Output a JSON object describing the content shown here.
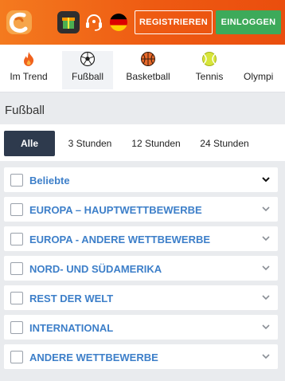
{
  "header": {
    "logo_icon": "bookmaker-logo-icon",
    "gift_icon": "gift-icon",
    "support_icon": "support-headset-icon",
    "flag_icon": "german-flag-icon",
    "register_label": "REGISTRIEREN",
    "login_label": "EINLOGGEN",
    "colors": {
      "bar": "#ee5a12",
      "login": "#3daa5a"
    }
  },
  "sport_tabs": [
    {
      "label": "Im Trend",
      "icon": "flame-icon",
      "active": false
    },
    {
      "label": "Fußball",
      "icon": "soccer-ball-icon",
      "active": true
    },
    {
      "label": "Basketball",
      "icon": "basketball-icon",
      "active": false
    },
    {
      "label": "Tennis",
      "icon": "tennis-ball-icon",
      "active": false
    },
    {
      "label": "Olympi",
      "icon": "",
      "active": false
    }
  ],
  "page_title": "Fußball",
  "time_filters": [
    {
      "label": "Alle",
      "active": true
    },
    {
      "label": "3 Stunden",
      "active": false
    },
    {
      "label": "12 Stunden",
      "active": false
    },
    {
      "label": "24 Stunden",
      "active": false
    }
  ],
  "leagues": [
    {
      "label": "Beliebte",
      "chevron": "chevron-down-icon-dark"
    },
    {
      "label": "EUROPA – HAUPTWETTBEWERBE",
      "chevron": "chevron-down-icon"
    },
    {
      "label": "EUROPA - ANDERE WETTBEWERBE",
      "chevron": "chevron-down-icon"
    },
    {
      "label": "NORD- UND SÜDAMERIKA",
      "chevron": "chevron-down-icon"
    },
    {
      "label": "REST DER WELT",
      "chevron": "chevron-down-icon"
    },
    {
      "label": "INTERNATIONAL",
      "chevron": "chevron-down-icon"
    },
    {
      "label": "ANDERE WETTBEWERBE",
      "chevron": "chevron-down-icon"
    }
  ]
}
